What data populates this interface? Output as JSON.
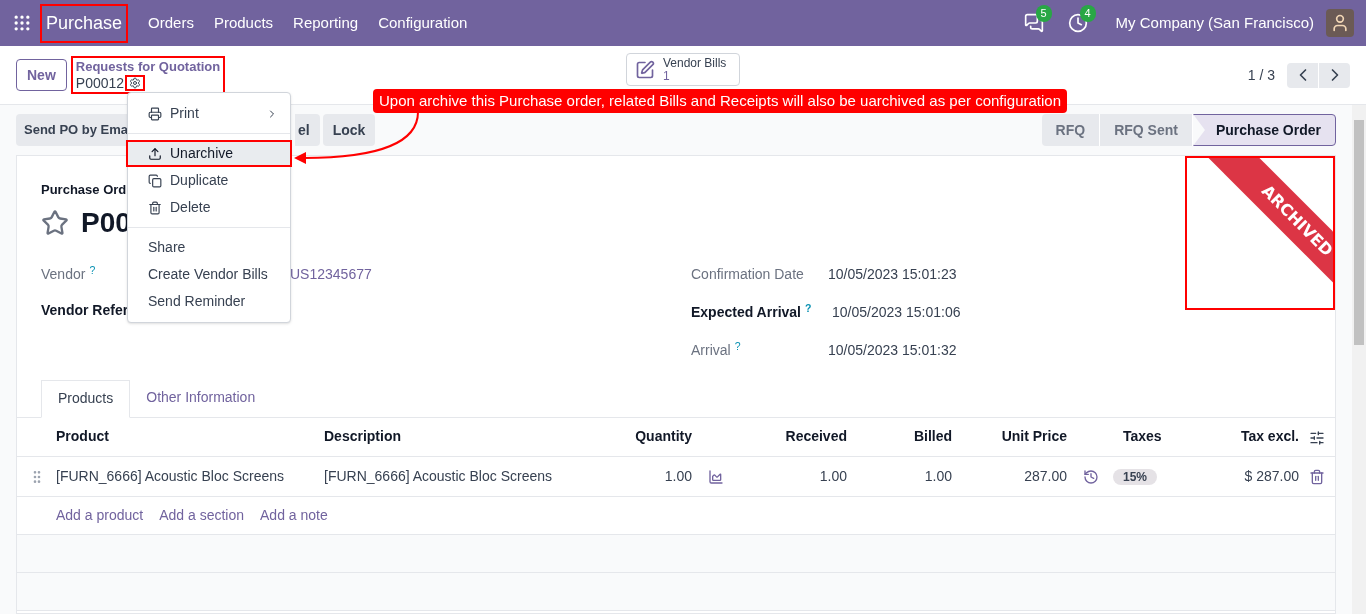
{
  "navbar": {
    "app_name": "Purchase",
    "menu": [
      "Orders",
      "Products",
      "Reporting",
      "Configuration"
    ],
    "messages_count": "5",
    "activities_count": "4",
    "company": "My Company (San Francisco)"
  },
  "control_panel": {
    "new_button": "New",
    "breadcrumb_parent": "Requests for Quotation",
    "record": "P00012",
    "smart_button": {
      "label": "Vendor Bills",
      "count": "1"
    },
    "pager": "1 / 3"
  },
  "action_buttons": [
    "Send PO by Ema",
    "el",
    "Lock"
  ],
  "status_bar": [
    {
      "label": "RFQ",
      "selected": false
    },
    {
      "label": "RFQ Sent",
      "selected": false
    },
    {
      "label": "Purchase Order",
      "selected": true
    }
  ],
  "form": {
    "title_label": "Purchase Ord",
    "name": "P00",
    "starred": false,
    "ribbon": "ARCHIVED",
    "left_fields": [
      {
        "label": "Vendor",
        "help": "?",
        "required": false,
        "value": "US12345677"
      },
      {
        "label": "Vendor Refer",
        "required": true
      }
    ],
    "right_fields": [
      {
        "label": "Confirmation Date",
        "required": false,
        "value": "10/05/2023 15:01:23"
      },
      {
        "label": "Expected Arrival",
        "help": "?",
        "required": true,
        "value": "10/05/2023 15:01:06"
      },
      {
        "label": "Arrival",
        "help": "?",
        "required": false,
        "value": "10/05/2023 15:01:32"
      }
    ]
  },
  "tabs": [
    {
      "label": "Products",
      "selected": true
    },
    {
      "label": "Other Information",
      "selected": false
    }
  ],
  "table": {
    "columns": [
      "Product",
      "Description",
      "Quantity",
      "Received",
      "Billed",
      "Unit Price",
      "Taxes",
      "Tax excl."
    ],
    "rows": [
      {
        "product": "[FURN_6666] Acoustic Bloc Screens",
        "description": "[FURN_6666] Acoustic Bloc Screens",
        "quantity": "1.00",
        "received": "1.00",
        "billed": "1.00",
        "unit_price": "287.00",
        "taxes": "15%",
        "tax_excl": "$ 287.00"
      }
    ],
    "add_links": [
      "Add a product",
      "Add a section",
      "Add a note"
    ]
  },
  "dropdown": {
    "groups": [
      [
        {
          "label": "Print",
          "submenu": true,
          "selected": false
        }
      ],
      [
        {
          "label": "Unarchive",
          "submenu": false,
          "selected": true
        },
        {
          "label": "Duplicate",
          "submenu": false,
          "selected": false
        },
        {
          "label": "Delete",
          "submenu": false,
          "selected": false
        }
      ],
      [
        {
          "label": "Share",
          "submenu": false,
          "selected": false
        },
        {
          "label": "Create Vendor Bills",
          "submenu": false,
          "selected": false
        },
        {
          "label": "Send Reminder",
          "submenu": false,
          "selected": false
        }
      ]
    ]
  },
  "annotation": "Upon archive this Purchase order, related Bills and Receipts will also be uarchived as per configuration"
}
